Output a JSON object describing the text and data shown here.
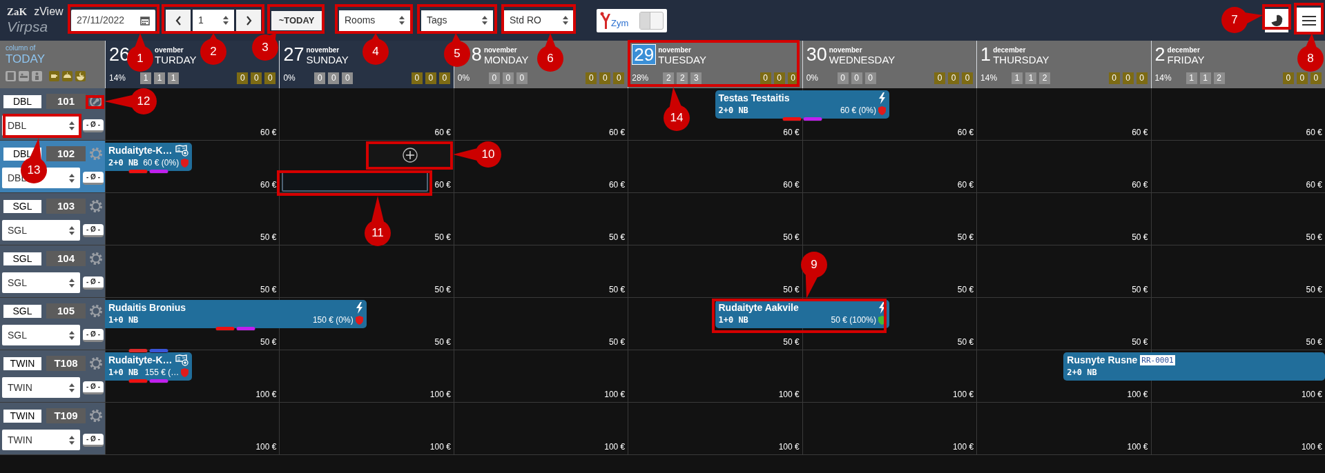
{
  "app": {
    "logo": "ZaK",
    "name": "zView",
    "property": "Virpsa"
  },
  "toolbar": {
    "date": "27/11/2022",
    "step": "1",
    "today_button": "~TODAY",
    "view_select": "Rooms",
    "tags_select": "Tags",
    "rate_select": "Std RO",
    "brand": "Zym",
    "toggle": {
      "on": false
    }
  },
  "today_column": {
    "label": "column of",
    "title": "TODAY"
  },
  "days": [
    {
      "kind": "covered-name",
      "day": "26",
      "month": "ovember",
      "weekday": "TURDAY",
      "occupancy": "14%",
      "counts": [
        "1",
        "1",
        "1"
      ],
      "meals": [
        "0",
        "0",
        "0"
      ],
      "weekend": true,
      "today": false
    },
    {
      "kind": "plain",
      "day": "27",
      "month": "november",
      "weekday": "SUNDAY",
      "occupancy": "0%",
      "counts": [
        "0",
        "0",
        "0"
      ],
      "meals": [
        "0",
        "0",
        "0"
      ],
      "weekend": true,
      "today": false
    },
    {
      "kind": "covered-number",
      "day": "8",
      "month": "november",
      "weekday": "MONDAY",
      "occupancy": "0%",
      "counts": [
        "0",
        "0",
        "0"
      ],
      "meals": [
        "0",
        "0",
        "0"
      ],
      "weekend": false,
      "today": false
    },
    {
      "kind": "plain",
      "day": "29",
      "month": "november",
      "weekday": "TUESDAY",
      "occupancy": "28%",
      "counts": [
        "2",
        "2",
        "3"
      ],
      "meals": [
        "0",
        "0",
        "0"
      ],
      "weekend": false,
      "today": true
    },
    {
      "kind": "plain",
      "day": "30",
      "month": "november",
      "weekday": "WEDNESDAY",
      "occupancy": "0%",
      "counts": [
        "0",
        "0",
        "0"
      ],
      "meals": [
        "0",
        "0",
        "0"
      ],
      "weekend": false,
      "today": false
    },
    {
      "kind": "plain",
      "day": "1",
      "month": "december",
      "weekday": "THURSDAY",
      "occupancy": "14%",
      "counts": [
        "1",
        "1",
        "2"
      ],
      "meals": [
        "0",
        "0",
        "0"
      ],
      "weekend": false,
      "today": false
    },
    {
      "kind": "plain",
      "day": "2",
      "month": "december",
      "weekday": "FRIDAY",
      "occupancy": "14%",
      "counts": [
        "1",
        "1",
        "2"
      ],
      "meals": [
        "0",
        "0",
        "0"
      ],
      "weekend": false,
      "today": false
    }
  ],
  "rooms": [
    {
      "kind": "wrench",
      "type": "DBL",
      "number": "101",
      "rate": "DBL",
      "rate_button": "- Ø -",
      "selected": false,
      "cells": [
        {
          "price": "60 €"
        },
        {
          "price": "60 €"
        },
        {
          "price": "60 €"
        },
        {
          "price": "60 €",
          "booking": {
            "name": "Testas Testaitis",
            "guests": "2+0 NB",
            "arrives": true,
            "tags_below": [
              {
                "color": "#ee1111"
              },
              {
                "color": "#c020ee"
              }
            ]
          }
        },
        {
          "price": "60 €",
          "checkout": {
            "kind": "bolt",
            "price": "60 € (0%)",
            "paid": false
          }
        },
        {
          "price": "60 €"
        },
        {
          "price": "60 €"
        }
      ]
    },
    {
      "kind": "gear",
      "type": "DBL",
      "number": "102",
      "rate": "DBL",
      "rate_button": "- Ø -",
      "selected": true,
      "cells": [
        {
          "price": "60 €",
          "booking": {
            "name": "Rudaityte-K…",
            "guests": "2+0 NB",
            "arrives": false,
            "tags_below": [
              {
                "color": "#ee1111"
              },
              {
                "color": "#c020ee"
              }
            ]
          },
          "checkout": {
            "kind": "note",
            "price": "60 € (0%)",
            "paid": false
          }
        },
        {
          "price": "60 €",
          "add_button": true,
          "slot": true
        },
        {
          "price": "60 €"
        },
        {
          "price": "60 €"
        },
        {
          "price": "60 €"
        },
        {
          "price": "60 €"
        },
        {
          "price": "60 €"
        }
      ]
    },
    {
      "kind": "gear",
      "type": "SGL",
      "number": "103",
      "rate": "SGL",
      "rate_button": "- Ø -",
      "selected": false,
      "cells": [
        {
          "price": "50 €"
        },
        {
          "price": "50 €"
        },
        {
          "price": "50 €"
        },
        {
          "price": "50 €"
        },
        {
          "price": "50 €"
        },
        {
          "price": "50 €"
        },
        {
          "price": "50 €"
        }
      ]
    },
    {
      "kind": "gear",
      "type": "SGL",
      "number": "104",
      "rate": "SGL",
      "rate_button": "- Ø -",
      "selected": false,
      "cells": [
        {
          "price": "50 €"
        },
        {
          "price": "50 €"
        },
        {
          "price": "50 €"
        },
        {
          "price": "50 €"
        },
        {
          "price": "50 €"
        },
        {
          "price": "50 €"
        },
        {
          "price": "50 €"
        }
      ]
    },
    {
      "kind": "gear",
      "type": "SGL",
      "number": "105",
      "rate": "SGL",
      "rate_button": "- Ø -",
      "selected": false,
      "cells": [
        {
          "price": "50 €",
          "booking": {
            "name": "Rudaitis Bronius",
            "guests": "1+0 NB",
            "arrives": false,
            "tags_below": [
              {
                "color": "#ee1111"
              },
              {
                "color": "#c020ee"
              }
            ]
          }
        },
        {
          "price": "50 €",
          "checkout": {
            "kind": "bolt",
            "price": "150 € (0%)",
            "paid": false
          }
        },
        {
          "price": "50 €"
        },
        {
          "price": "50 €",
          "booking": {
            "name": "Rudaityte Aakvile",
            "guests": "1+0 NB",
            "arrives": true
          }
        },
        {
          "price": "50 €",
          "checkout": {
            "kind": "bolt",
            "price": "50 € (100%)",
            "paid": true
          }
        },
        {
          "price": "50 €"
        },
        {
          "price": "50 €"
        }
      ]
    },
    {
      "kind": "gear",
      "type": "TWIN",
      "number": "T108",
      "rate": "TWIN",
      "rate_button": "- Ø -",
      "selected": false,
      "cells": [
        {
          "price": "100 €",
          "booking": {
            "name": "Rudaityte-K…",
            "guests": "1+0 NB",
            "arrives": false,
            "tags_above": [
              {
                "color": "#dd2a2a"
              },
              {
                "color": "#3a55d8"
              }
            ],
            "tags_below": [
              {
                "color": "#ee1111"
              },
              {
                "color": "#c020ee"
              }
            ]
          },
          "checkout": {
            "kind": "note",
            "price": "155 € (…",
            "paid": false
          }
        },
        {
          "price": "100 €"
        },
        {
          "price": "100 €"
        },
        {
          "price": "100 €"
        },
        {
          "price": "100 €"
        },
        {
          "price": "100 €",
          "booking": {
            "name": "Rusnyte Rusne",
            "code": "RR-0001",
            "guests": "2+0 NB",
            "arrives": true
          }
        },
        {
          "price": "100 €"
        }
      ]
    },
    {
      "kind": "gear",
      "type": "TWIN",
      "number": "T109",
      "rate": "TWIN",
      "rate_button": "- Ø -",
      "selected": false,
      "cells": [
        {
          "price": "100 €"
        },
        {
          "price": "100 €"
        },
        {
          "price": "100 €"
        },
        {
          "price": "100 €"
        },
        {
          "price": "100 €"
        },
        {
          "price": "100 €"
        },
        {
          "price": "100 €"
        }
      ]
    }
  ],
  "callouts": [
    {
      "label": "1"
    },
    {
      "label": "2"
    },
    {
      "label": "3"
    },
    {
      "label": "4"
    },
    {
      "label": "5"
    },
    {
      "label": "6"
    },
    {
      "label": "7"
    },
    {
      "label": "8"
    },
    {
      "label": "9"
    },
    {
      "label": "10"
    },
    {
      "label": "11"
    },
    {
      "label": "12"
    },
    {
      "label": "13"
    },
    {
      "label": "14"
    }
  ]
}
